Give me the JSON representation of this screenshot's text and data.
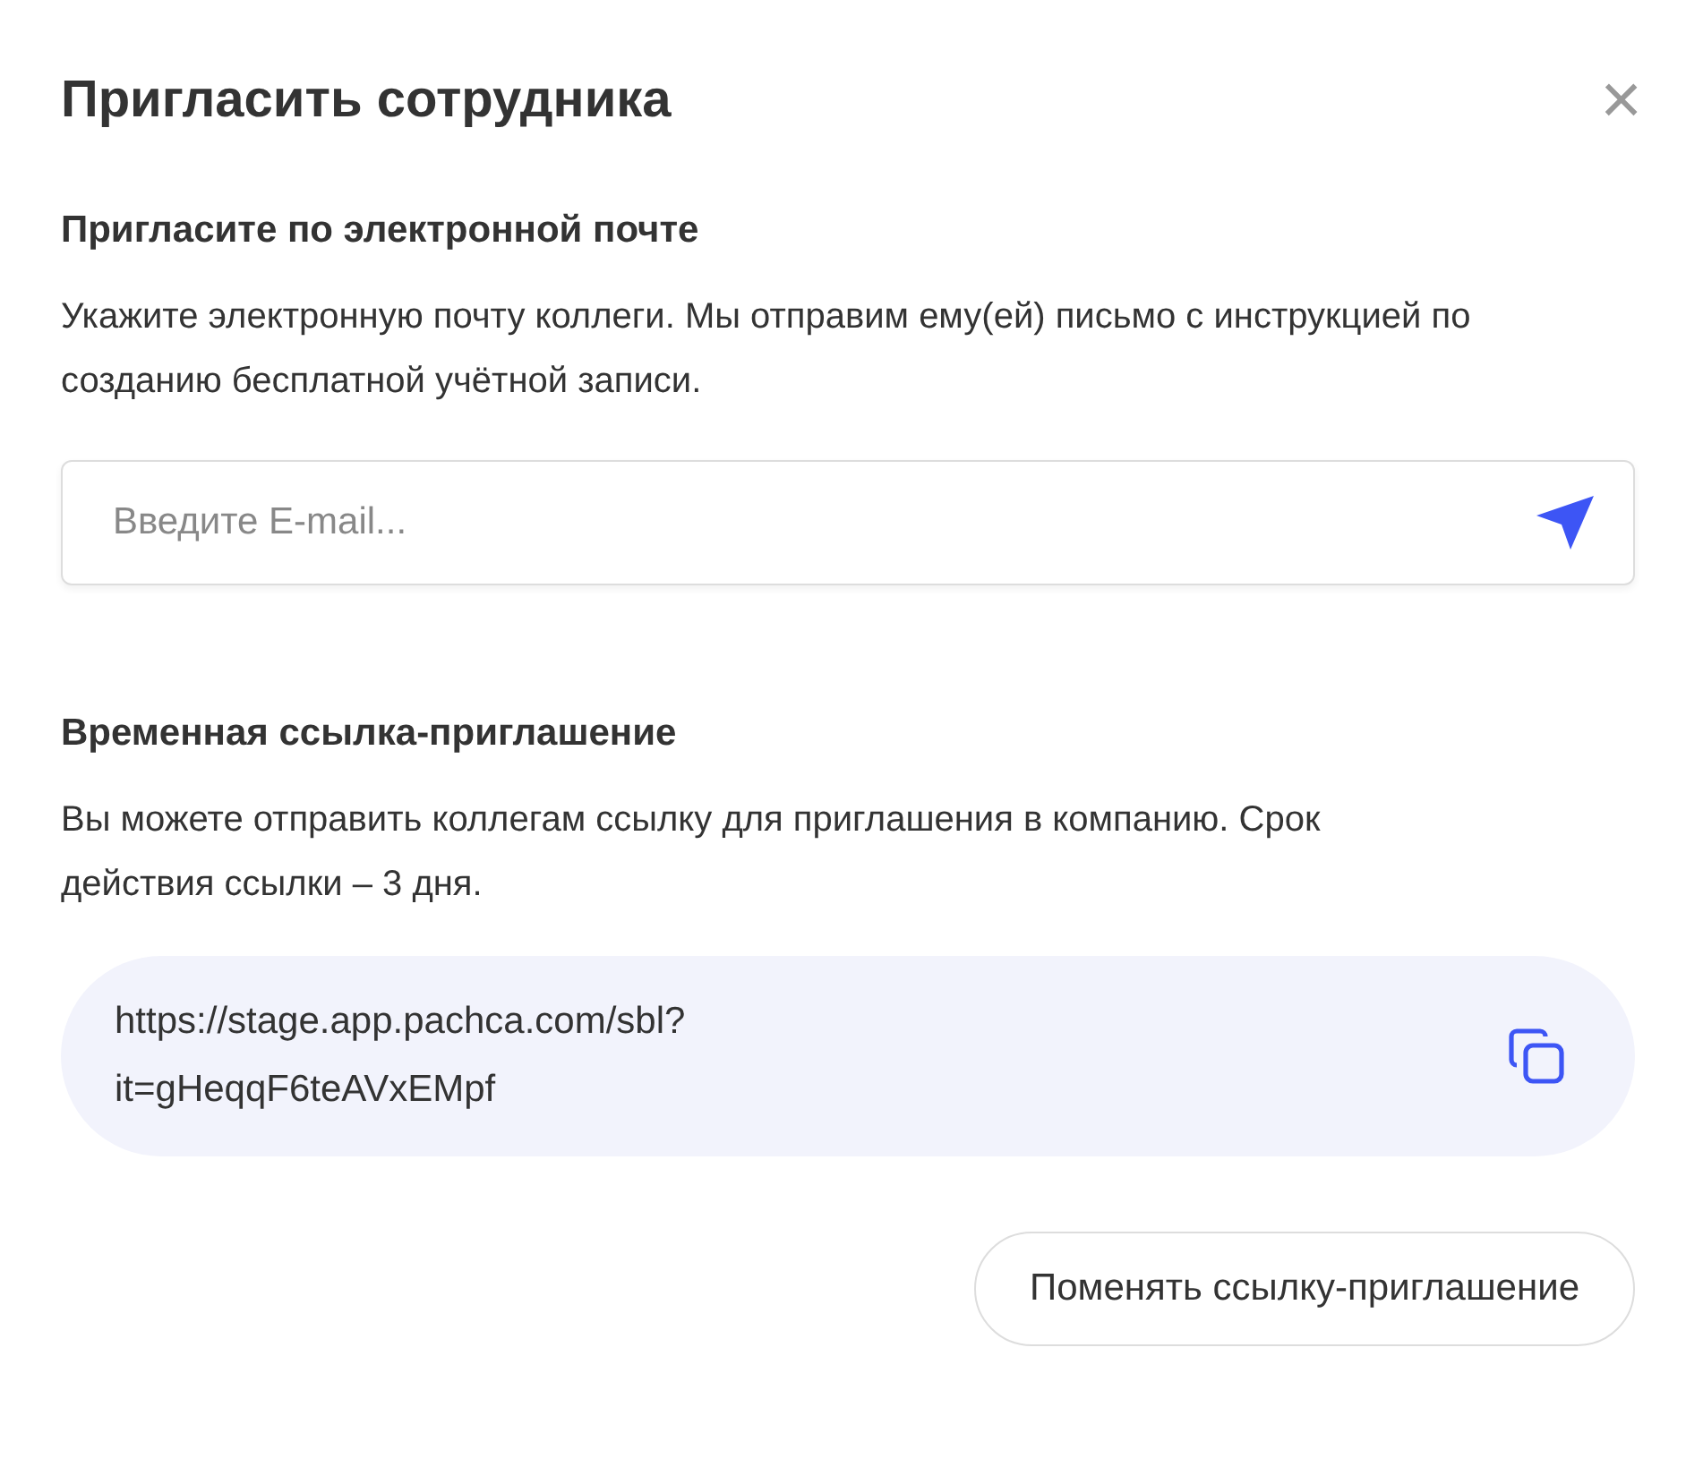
{
  "dialog": {
    "title": "Пригласить сотрудника",
    "close": "×"
  },
  "email_section": {
    "heading": "Пригласите по электронной почте",
    "description": "Укажите электронную почту коллеги. Мы отправим ему(ей) письмо с инструкцией по созданию бесплатной учётной записи.",
    "input": {
      "placeholder": "Введите E-mail..."
    }
  },
  "link_section": {
    "heading": "Временная ссылка-приглашение",
    "description": "Вы можете отправить коллегам ссылку для приглашения в компанию. Срок действия ссылки – 3 дня.",
    "link": "https://stage.app.pachca.com/sbl?it=gHeqqF6teAVxEMpf"
  },
  "buttons": [
    "Поменять ссылку-приглашение"
  ]
}
